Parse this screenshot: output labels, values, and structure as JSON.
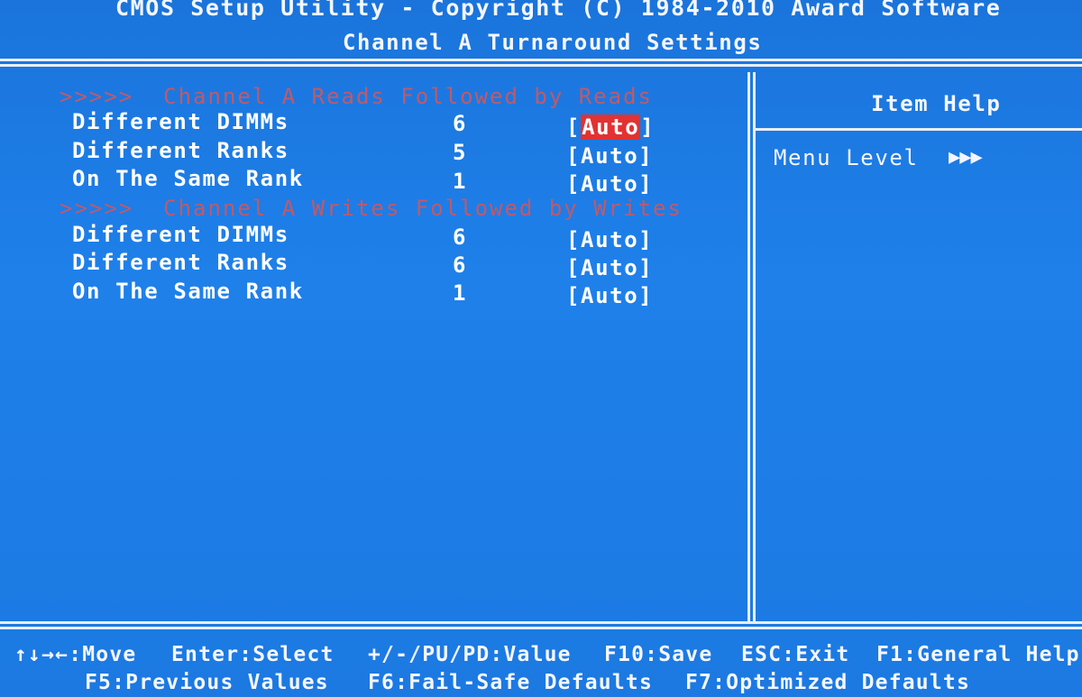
{
  "header": {
    "line1": "CMOS Setup Utility - Copyright (C) 1984-2010 Award Software",
    "line2": "Channel A Turnaround Settings"
  },
  "sections": [
    {
      "heading": ">>>>>  Channel A Reads Followed by Reads",
      "items": [
        {
          "label": "Different DIMMs",
          "value": "6",
          "option": "[Auto]",
          "selected": true
        },
        {
          "label": "Different Ranks",
          "value": "5",
          "option": "[Auto]",
          "selected": false
        },
        {
          "label": "On The Same Rank",
          "value": "1",
          "option": "[Auto]",
          "selected": false
        }
      ]
    },
    {
      "heading": ">>>>>  Channel A Writes Followed by Writes",
      "items": [
        {
          "label": "Different DIMMs",
          "value": "6",
          "option": "[Auto]",
          "selected": false
        },
        {
          "label": "Different Ranks",
          "value": "6",
          "option": "[Auto]",
          "selected": false
        },
        {
          "label": "On The Same Rank",
          "value": "1",
          "option": "[Auto]",
          "selected": false
        }
      ]
    }
  ],
  "help": {
    "title": "Item Help",
    "menu_level_label": "Menu Level",
    "menu_level_arrows": "▶▶▶"
  },
  "footer": {
    "row1": [
      "↑↓→←:Move",
      "Enter:Select",
      "+/-/PU/PD:Value",
      "F10:Save",
      "ESC:Exit",
      "F1:General Help"
    ],
    "row2": [
      "F5:Previous Values",
      "F6:Fail-Safe Defaults",
      "F7:Optimized Defaults"
    ]
  },
  "colors": {
    "background": "#1f7ae0",
    "text": "#ffffff",
    "section_heading": "#bf5a6a",
    "selection": "#e23232"
  }
}
